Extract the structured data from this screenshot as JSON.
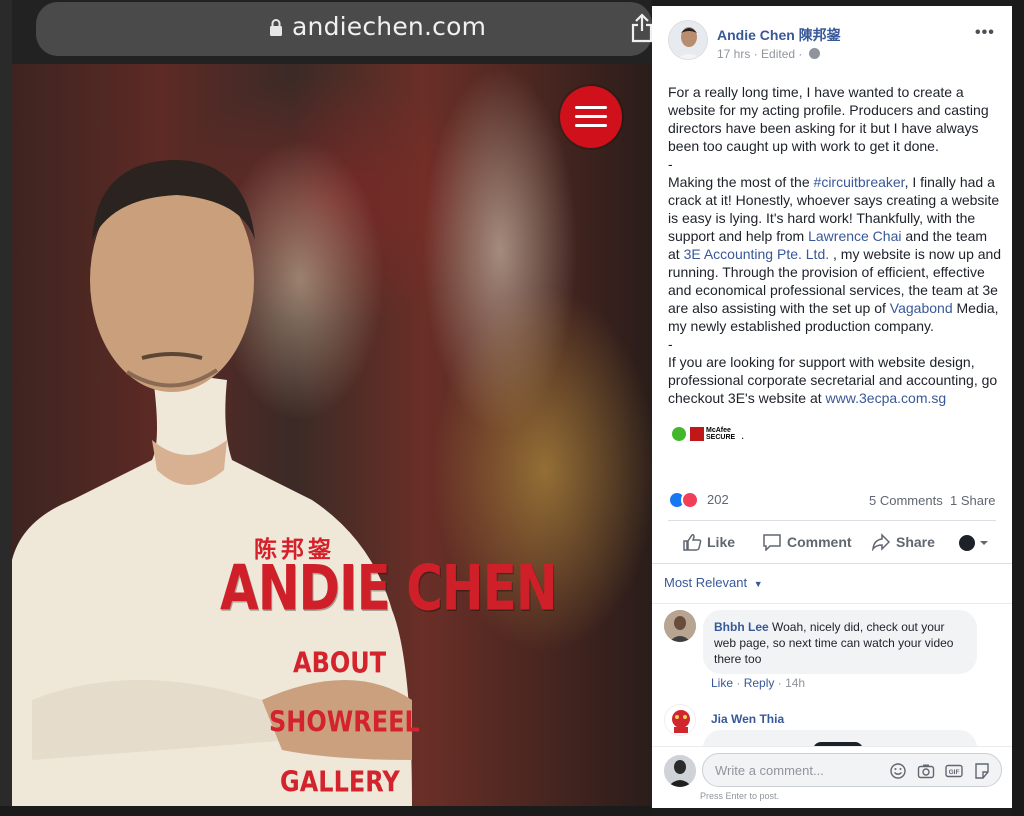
{
  "browser": {
    "url": "andiechen.com"
  },
  "website": {
    "brand_chinese": "陈邦鋆",
    "brand_name": "ANDIE CHEN",
    "nav": [
      "ABOUT",
      "SHOWREEL",
      "GALLERY"
    ]
  },
  "post": {
    "author": "Andie Chen 陳邦鋆",
    "time": "17 hrs",
    "edited": "Edited",
    "more": "•••",
    "body": {
      "p1": "For a really long time, I have wanted to create a website for my acting profile. Producers and casting directors have been asking for it but I have always been too caught up with work to get it done.",
      "sep1": "-",
      "p2_a": "Making the most of the ",
      "p2_link1": "#circuitbreaker",
      "p2_b": ", I finally had a crack at it! Honestly, whoever says creating a website is easy is lying. It's hard work! Thankfully, with the support and help from ",
      "p2_link2": "Lawrence Chai",
      "p2_c": " and the team at ",
      "p2_link3": "3E Accounting Pte. Ltd.",
      "p2_d": " , my website is now up and running. Through the provision of efficient, effective and economical professional services, the team at 3e are also assisting with the set up of ",
      "p2_link4": "Vagabond",
      "p2_e": " Media, my newly established production company.",
      "sep2": "-",
      "p3_a": "If you are looking for support with website design, professional corporate secretarial and accounting, go checkout 3E's website at ",
      "p3_link": "www.3ecpa.com.sg"
    },
    "badge_text_1": "McAfee",
    "badge_text_2": "SECURE",
    "badge_dot": ".",
    "reactions_count": "202",
    "comments_count": "5 Comments",
    "shares_count": "1 Share",
    "actions": {
      "like": "Like",
      "comment": "Comment",
      "share": "Share"
    },
    "sort": "Most Relevant",
    "comments": [
      {
        "author": "Bhbh Lee",
        "text": "Woah, nicely did, check out your web page, so next time can watch your video there too",
        "like": "Like",
        "reply": "Reply",
        "time": "14h"
      },
      {
        "author": "Jia Wen Thia"
      }
    ],
    "composer": {
      "placeholder": "Write a comment...",
      "hint": "Press Enter to post."
    }
  },
  "colors": {
    "fb_link": "#385898",
    "brand_red": "#d0101a"
  },
  "icons": [
    "lock-icon",
    "share-icon",
    "menu-icon",
    "globe-icon",
    "like-icon",
    "comment-icon",
    "share-arrow-icon",
    "emoji-icon",
    "camera-icon",
    "gif-icon",
    "sticker-icon"
  ]
}
